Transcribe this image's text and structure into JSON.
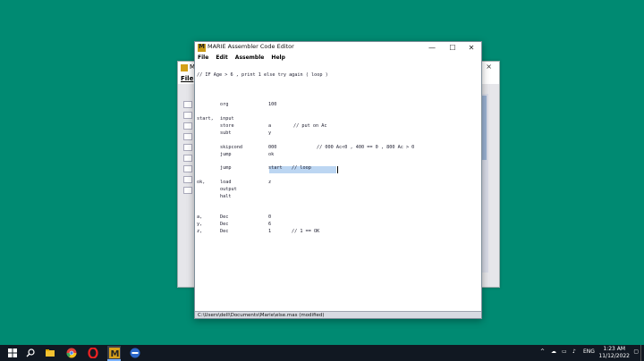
{
  "background_window": {
    "title": "M",
    "menu_file": "File",
    "close": "×"
  },
  "window": {
    "title": "MARIE Assembler Code Editor",
    "controls": {
      "minimize": "—",
      "maximize": "☐",
      "close": "✕"
    }
  },
  "menu": [
    "File",
    "Edit",
    "Assemble",
    "Help"
  ],
  "code": {
    "comment_header": "// IF Age > 6 , print 1 else try again ( loop )",
    "lines": [
      {
        "label": "",
        "instr": "org",
        "operand": "100",
        "comment": ""
      },
      {
        "label": "start,",
        "instr": "input",
        "operand": "",
        "comment": ""
      },
      {
        "label": "",
        "instr": "store",
        "operand": "a",
        "comment": "// put on Ac"
      },
      {
        "label": "",
        "instr": "subt",
        "operand": "y",
        "comment": ""
      },
      {
        "label": "",
        "instr": "skipcond",
        "operand": "000",
        "comment": "// 000 Ac<0 , 400 == 0 , 800 Ac > 0"
      },
      {
        "label": "",
        "instr": "jump",
        "operand": "ok",
        "comment": ""
      },
      {
        "label": "",
        "instr": "jump",
        "operand": "start",
        "comment": "// loop"
      },
      {
        "label": "ok,",
        "instr": "load",
        "operand": "z",
        "comment": ""
      },
      {
        "label": "",
        "instr": "output",
        "operand": "",
        "comment": ""
      },
      {
        "label": "",
        "instr": "halt",
        "operand": "",
        "comment": ""
      },
      {
        "label": "a,",
        "instr": "Dec",
        "operand": "0",
        "comment": ""
      },
      {
        "label": "y,",
        "instr": "Dec",
        "operand": "6",
        "comment": ""
      },
      {
        "label": "z,",
        "instr": "Dec",
        "operand": "1",
        "comment": "// 1 == OK"
      }
    ]
  },
  "status": "C:\\Users\\dell\\Documents\\Marie\\else.mas (modified)",
  "taskbar": {
    "icons": [
      "windows-icon",
      "search-icon",
      "task-view-icon",
      "file-explorer-icon",
      "chrome-icon",
      "opera-icon",
      "marie-icon",
      "app-icon"
    ],
    "time": "1:23 AM",
    "date": "11/12/2022",
    "lang": "ENG"
  }
}
